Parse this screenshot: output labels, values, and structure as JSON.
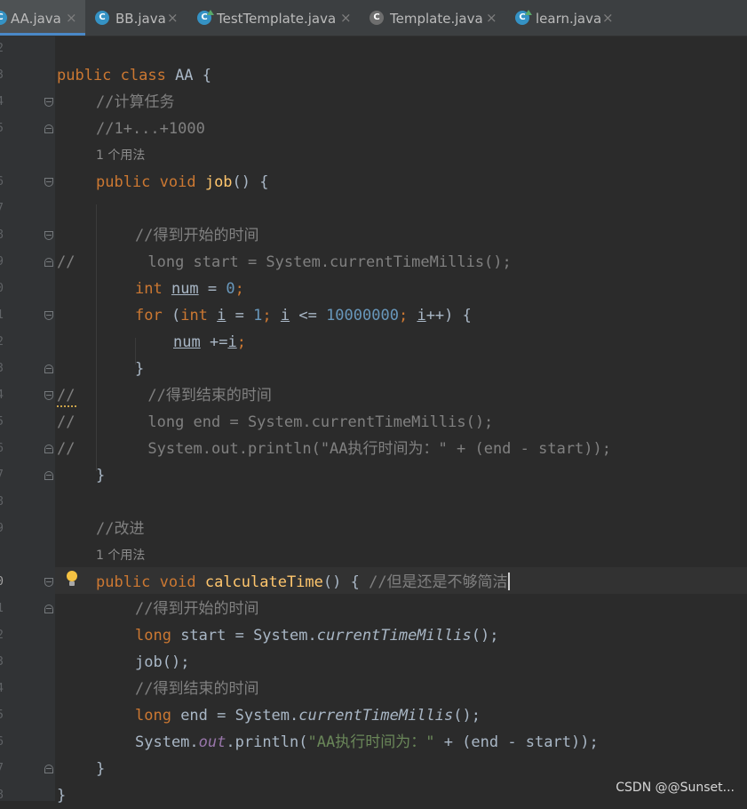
{
  "tabs": [
    {
      "label": "AA.java",
      "icon": "class-icon",
      "active": true
    },
    {
      "label": "BB.java",
      "icon": "class-icon"
    },
    {
      "label": "TestTemplate.java",
      "icon": "runnable-class-icon"
    },
    {
      "label": "Template.java",
      "icon": "abstract-class-icon"
    },
    {
      "label": "learn.java",
      "icon": "runnable-class-icon"
    }
  ],
  "gutter": {
    "line_numbers": [
      "2",
      "3",
      "4",
      "5",
      "",
      "6",
      "7",
      "8",
      "9",
      "0",
      "1",
      "2",
      "3",
      "4",
      "5",
      "6",
      "7",
      "8",
      "9",
      "",
      "0",
      "1",
      "2",
      "3",
      "4",
      "5",
      "6",
      "7",
      "8"
    ]
  },
  "editor": {
    "usage_hints": [
      "1 个用法",
      "1 个用法"
    ],
    "code_lines": [
      {
        "t1": "public class ",
        "t2": "AA",
        "t3": " {"
      },
      {
        "t1": "//计算任务"
      },
      {
        "t1": "//1+...+1000"
      },
      {
        "t1": "public void ",
        "t2": "job",
        "t3": "() {"
      },
      {
        "t1": "//得到开始的时间"
      },
      {
        "t1": "//",
        "t2": "        long start = System.currentTimeMillis();"
      },
      {
        "t1": "int ",
        "t2": "num",
        "t3": " = ",
        "t4": "0",
        "t5": ";"
      },
      {
        "t1": "for ",
        "t2": "(",
        "t3": "int ",
        "t4": "i",
        "t5": " = ",
        "t6": "1",
        "t7": "; ",
        "t8": "i",
        "t9": " <= ",
        "t10": "10000000",
        "t11": "; ",
        "t12": "i",
        "t13": "++) {"
      },
      {
        "t1": "num",
        "t2": " +=",
        "t3": "i",
        "t4": ";"
      },
      {
        "t1": "}"
      },
      {
        "t1": "//",
        "t2": "        //得到结束的时间"
      },
      {
        "t1": "//",
        "t2": "        long end = System.currentTimeMillis();"
      },
      {
        "t1": "//",
        "t2": "        System.out.println(\"AA执行时间为：\" + (end - start));"
      },
      {
        "t1": "}"
      },
      {
        "t1": "//改进"
      },
      {
        "t1": "public void ",
        "t2": "calculateTime",
        "t3": "() { ",
        "t4": "//但是还是不够简洁"
      },
      {
        "t1": "//得到开始的时间"
      },
      {
        "t1": "long ",
        "t2": "start = System.",
        "t3": "currentTimeMillis",
        "t4": "();"
      },
      {
        "t1": "job",
        "t2": "();"
      },
      {
        "t1": "//得到结束的时间"
      },
      {
        "t1": "long ",
        "t2": "end = System.",
        "t3": "currentTimeMillis",
        "t4": "();"
      },
      {
        "t1": "System.",
        "t2": "out",
        "t3": ".println(",
        "t4": "\"AA执行时间为：\"",
        "t5": " + (end - start));"
      },
      {
        "t1": "}"
      },
      {
        "t1": "}"
      }
    ]
  },
  "watermark": "CSDN @@Sunset...",
  "colors": {
    "background": "#2b2b2b",
    "keyword": "#cc7832",
    "comment": "#808080",
    "method": "#ffc66d",
    "number": "#6897bb",
    "string": "#6a8759",
    "field": "#9876aa",
    "default_text": "#a9b7c6",
    "active_tab_underline": "#4a88c7"
  }
}
